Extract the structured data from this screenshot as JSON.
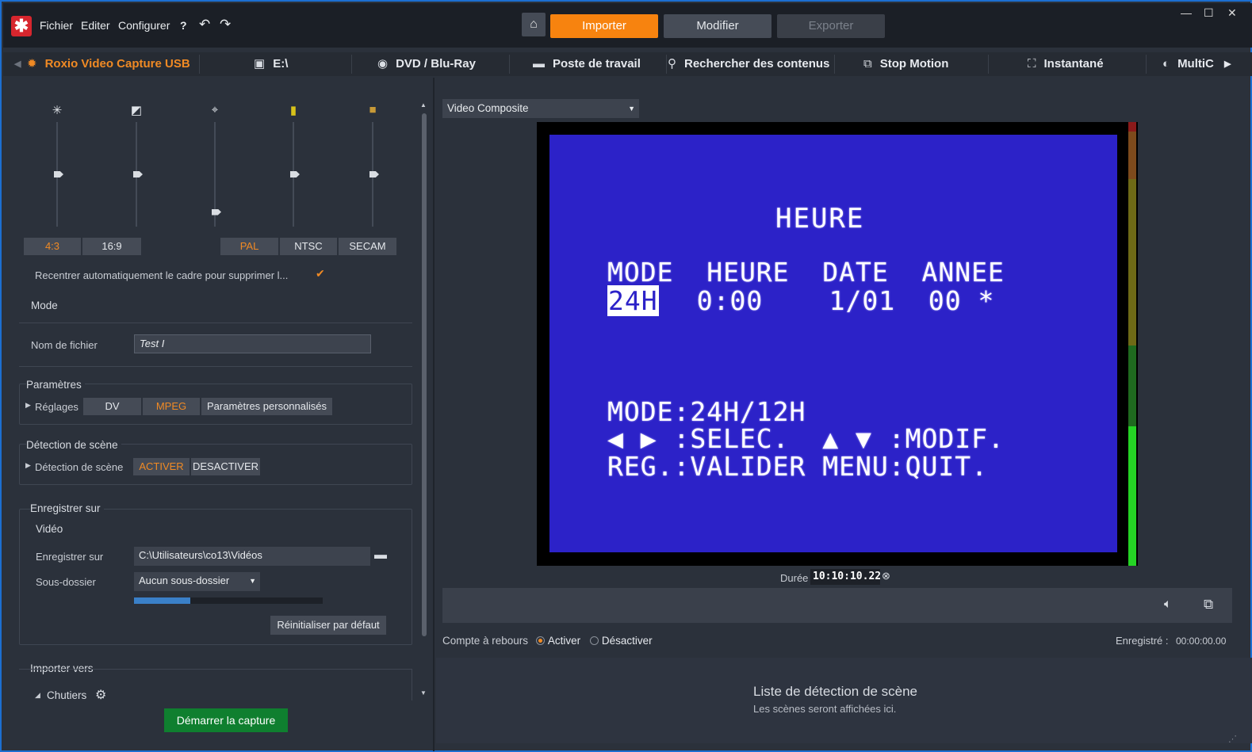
{
  "menu": {
    "logo_glyph": "✱",
    "items": [
      "Fichier",
      "Editer",
      "Configurer"
    ],
    "help": "?",
    "undo": "↶",
    "redo": "↷"
  },
  "mode_buttons": {
    "home": "⌂",
    "import": "Importer",
    "edit": "Modifier",
    "export": "Exporter"
  },
  "window_controls": {
    "minimize": "—",
    "maximize": "☐",
    "close": "✕"
  },
  "tabs": {
    "device": "Roxio Video Capture USB",
    "drive": "E:\\",
    "dvd": "DVD / Blu-Ray",
    "workstation": "Poste de travail",
    "search": "Rechercher des contenus",
    "stop_motion": "Stop Motion",
    "snapshot": "Instantané",
    "multi": "MultiC"
  },
  "sliders": {
    "icons": [
      "✳",
      "◩",
      "⌖",
      "▮",
      "■"
    ],
    "values_percent": [
      50,
      50,
      14,
      50,
      50
    ]
  },
  "aspect": {
    "a43": "4:3",
    "a169": "16:9",
    "selected": "4:3"
  },
  "standard": {
    "pal": "PAL",
    "ntsc": "NTSC",
    "secam": "SECAM",
    "selected": "PAL"
  },
  "recenter_label": "Recentrer automatiquement le cadre pour supprimer l...",
  "mode_label": "Mode",
  "filename": {
    "label": "Nom de fichier",
    "value": "Test I"
  },
  "params": {
    "title": "Paramètres",
    "settings_label": "Réglages",
    "dv": "DV",
    "mpeg": "MPEG",
    "custom": "Paramètres personnalisés"
  },
  "scene": {
    "title": "Détection de scène",
    "row_label": "Détection de scène",
    "on": "ACTIVER",
    "off": "DESACTIVER"
  },
  "save": {
    "title": "Enregistrer sur",
    "video_label": "Vidéo",
    "path_label": "Enregistrer sur",
    "path_value": "C:\\Utilisateurs\\co13\\Vidéos",
    "subfolder_label": "Sous-dossier",
    "subfolder_value": "Aucun sous-dossier",
    "disk_usage_percent": 30,
    "reset": "Réinitialiser par défaut"
  },
  "import_to": {
    "title": "Importer vers",
    "bins": "Chutiers"
  },
  "start_capture": "Démarrer la capture",
  "source_select": "Video Composite",
  "video_screen": {
    "line1": "HEURE",
    "line2": "MODE  HEURE  DATE  ANNEE",
    "line3_hl": "24H",
    "line3": "  0:00    1/01  00 *",
    "line4": "MODE:24H/12H",
    "line5": "◀ ▶ :SELEC.  ▲ ▼ :MODIF.",
    "line6": "REG.:VALIDER MENU:QUIT."
  },
  "duration": {
    "label": "Durée",
    "value": "10:10:10.22"
  },
  "countdown": {
    "label": "Compte à rebours",
    "on": "Activer",
    "off": "Désactiver"
  },
  "recorded": {
    "label": "Enregistré :",
    "value": "00:00:00.00"
  },
  "scene_list": {
    "title": "Liste de détection de scène",
    "subtitle": "Les scènes seront affichées ici."
  },
  "colors": {
    "accent": "#f08a24",
    "capture_green": "#0f7f2f",
    "window_border": "#1c6fd1"
  }
}
